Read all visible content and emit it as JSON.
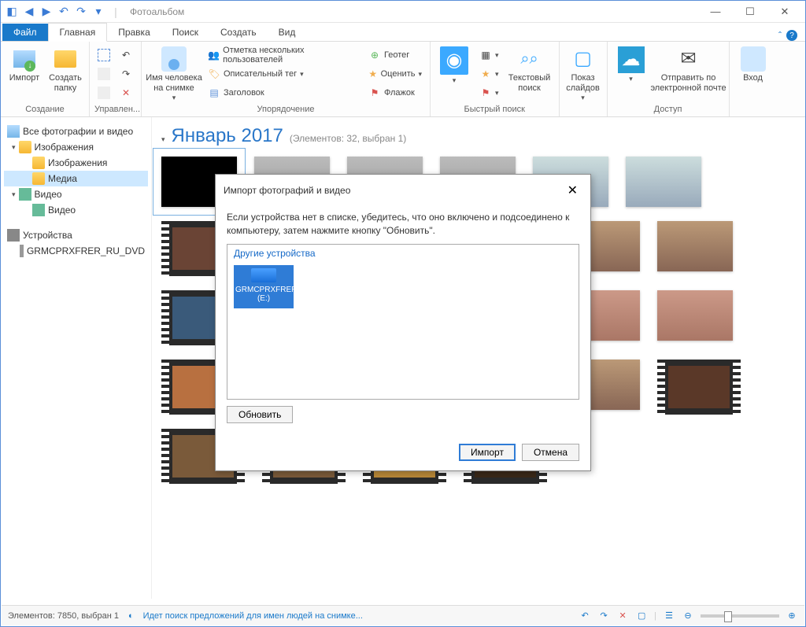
{
  "titlebar": {
    "app_title": "Фотоальбом"
  },
  "menu": {
    "file": "Файл",
    "tabs": [
      "Главная",
      "Правка",
      "Поиск",
      "Создать",
      "Вид"
    ],
    "active_index": 0
  },
  "ribbon": {
    "group_create": {
      "label": "Создание",
      "import": "Импорт",
      "create_folder": "Создать\nпапку"
    },
    "group_manage": {
      "label": "Управлен..."
    },
    "group_org": {
      "label": "Упорядочение",
      "person": "Имя человека\nна снимке",
      "mark_people": "Отметка нескольких пользователей",
      "desc_tag": "Описательный тег",
      "title_cmd": "Заголовок",
      "geotag": "Геотег",
      "rate": "Оценить",
      "flag": "Флажок"
    },
    "group_quick": {
      "label": "Быстрый поиск",
      "text_search": "Текстовый\nпоиск"
    },
    "group_slides": {
      "label": "",
      "slides": "Показ\nслайдов"
    },
    "group_access": {
      "label": "Доступ",
      "email": "Отправить по\nэлектронной почте"
    },
    "group_login": {
      "label": "",
      "login": "Вход"
    }
  },
  "sidebar": {
    "all": "Все фотографии и видео",
    "images_root": "Изображения",
    "images": "Изображения",
    "media": "Медиа",
    "video_root": "Видео",
    "video": "Видео",
    "devices": "Устройства",
    "device_name": "GRMCPRXFRER_RU_DVD"
  },
  "content": {
    "heading": "Январь 2017",
    "sub": "(Элементов: 32, выбран 1)"
  },
  "dialog": {
    "title": "Импорт фотографий и видео",
    "text": "Если устройства нет в списке, убедитесь, что оно включено и подсоединено к компьютеру, затем нажмите кнопку \"Обновить\".",
    "section": "Другие устройства",
    "device": "GRMCPRXFRER_RU_DVD (E:)",
    "refresh": "Обновить",
    "import": "Импорт",
    "cancel": "Отмена"
  },
  "status": {
    "left": "Элементов: 7850, выбран 1",
    "busy": "Идет поиск предложений для имен людей на снимке..."
  }
}
